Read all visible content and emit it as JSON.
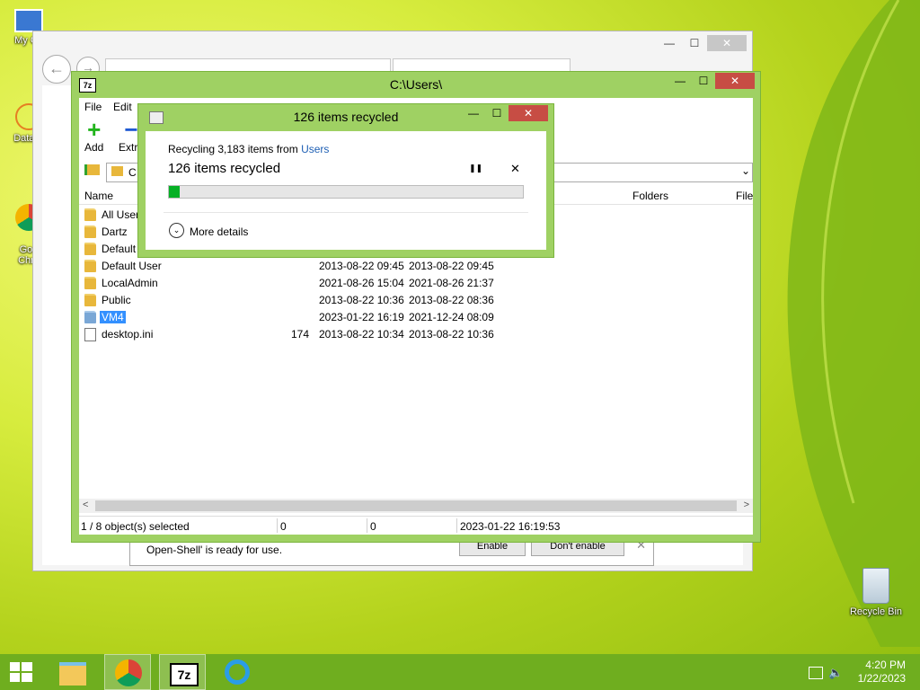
{
  "desktop": {
    "icons": [
      {
        "label": "My Co"
      },
      {
        "label": "DataW"
      },
      {
        "label": "Goo\nChro"
      },
      {
        "label": "Recycle Bin"
      }
    ]
  },
  "ie": {
    "minimize": "—",
    "maximize": "☐",
    "close": "✕",
    "back": "←",
    "forward": "→"
  },
  "notification": {
    "message": "Open-Shell' is ready for use.",
    "enable": "Enable",
    "dont_enable": "Don't enable",
    "close": "✕"
  },
  "zip": {
    "logo": "7z",
    "title": "C:\\Users\\",
    "minimize": "—",
    "maximize": "☐",
    "close": "✕",
    "menu": [
      "File",
      "Edit"
    ],
    "toolbar": {
      "add": "Add",
      "extract": "Extra"
    },
    "addr_partial": "C",
    "columns": {
      "name": "Name",
      "folders": "Folders",
      "files": "File"
    },
    "rows": [
      {
        "name": "All Users",
        "size": "",
        "modified": "",
        "created": "",
        "type": "folder"
      },
      {
        "name": "Dartz",
        "size": "",
        "modified": "",
        "created": "",
        "type": "folder"
      },
      {
        "name": "Default",
        "size": "",
        "modified": "",
        "created": "",
        "type": "folder"
      },
      {
        "name": "Default User",
        "size": "",
        "modified": "2013-08-22 09:45",
        "created": "2013-08-22 09:45",
        "type": "folder"
      },
      {
        "name": "LocalAdmin",
        "size": "",
        "modified": "2021-08-26 15:04",
        "created": "2021-08-26 21:37",
        "type": "folder"
      },
      {
        "name": "Public",
        "size": "",
        "modified": "2013-08-22 10:36",
        "created": "2013-08-22 08:36",
        "type": "folder"
      },
      {
        "name": "VM4",
        "size": "",
        "modified": "2023-01-22 16:19",
        "created": "2021-12-24 08:09",
        "type": "folder",
        "selected": true
      },
      {
        "name": "desktop.ini",
        "size": "174",
        "modified": "2013-08-22 10:34",
        "created": "2013-08-22 10:36",
        "type": "file"
      }
    ],
    "status": {
      "selected": "1 / 8 object(s) selected",
      "size1": "0",
      "size2": "0",
      "datetime": "2023-01-22 16:19:53"
    },
    "scroll_left": "<",
    "scroll_right": ">"
  },
  "progress": {
    "title": "126 items recycled",
    "recycling_prefix": "Recycling 3,183 items from",
    "source_link": "Users",
    "count_text": "126 items recycled",
    "pause": "❚❚",
    "cancel": "✕",
    "percent": 3,
    "more_details": "More details",
    "expand": "⌄",
    "minimize": "—",
    "maximize": "☐",
    "close": "✕"
  },
  "taskbar": {
    "time": "4:20 PM",
    "date": "1/22/2023"
  },
  "colors": {
    "accent_green": "#9fd163",
    "progress_fill": "#06b025",
    "close_red": "#c74d44",
    "link_blue": "#1e5fb4",
    "selection": "#3390ff"
  }
}
